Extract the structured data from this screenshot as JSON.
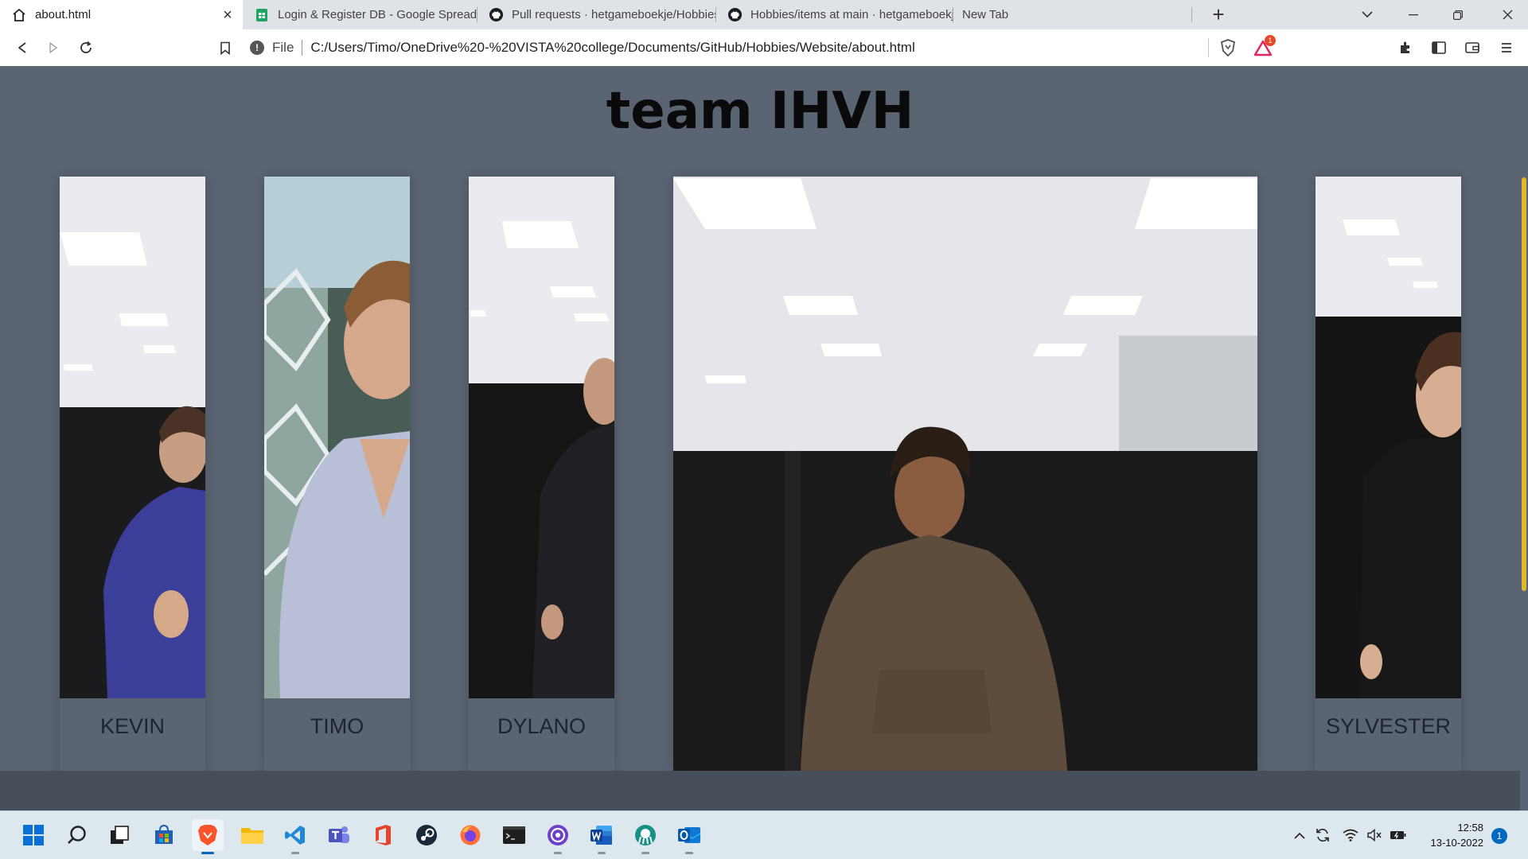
{
  "browser": {
    "tabs": [
      {
        "title": "about.html",
        "icon": "home-icon"
      },
      {
        "title": "Login & Register DB - Google Spreadsheets",
        "icon": "sheets-icon"
      },
      {
        "title": "Pull requests · hetgameboekje/Hobbies",
        "icon": "github-icon"
      },
      {
        "title": "Hobbies/items at main · hetgameboekje/Hobbies",
        "icon": "github-icon"
      },
      {
        "title": "New Tab",
        "icon": ""
      }
    ],
    "address": {
      "scheme": "File",
      "url": "C:/Users/Timo/OneDrive%20-%20VISTA%20college/Documents/GitHub/Hobbies/Website/about.html"
    },
    "extension_badge": "1"
  },
  "page": {
    "title": "team IHVH",
    "members": [
      {
        "name": "KEVIN"
      },
      {
        "name": "TIMO"
      },
      {
        "name": "DYLANO"
      },
      {
        "name": ""
      },
      {
        "name": "SYLVESTER"
      }
    ]
  },
  "taskbar": {
    "apps": [
      "start-icon",
      "search-icon",
      "task-view-icon",
      "store-icon",
      "brave-icon",
      "file-explorer-icon",
      "vscode-icon",
      "teams-icon",
      "office-icon",
      "steam-icon",
      "firefox-icon",
      "terminal-icon",
      "github-desktop-icon",
      "word-icon",
      "gitkraken-icon",
      "outlook-icon"
    ],
    "time": "12:58",
    "date": "13-10-2022",
    "notifications": "1"
  }
}
